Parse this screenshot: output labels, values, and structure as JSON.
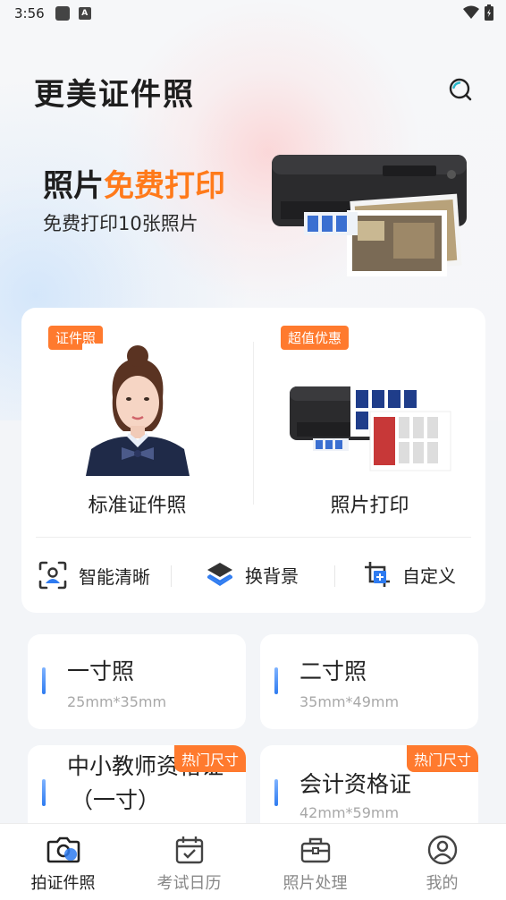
{
  "status_bar": {
    "time": "3:56"
  },
  "header": {
    "title": "更美证件照"
  },
  "promo": {
    "headline_plain": "照片",
    "headline_accent": "免费打印",
    "subtext": "免费打印10张照片"
  },
  "features": {
    "left": {
      "badge": "证件照",
      "label": "标准证件照"
    },
    "right": {
      "badge": "超值优惠",
      "label": "照片打印"
    }
  },
  "tools": [
    {
      "label": "智能清晰",
      "icon": "face-scan-icon"
    },
    {
      "label": "换背景",
      "icon": "layers-icon"
    },
    {
      "label": "自定义",
      "icon": "crop-add-icon"
    }
  ],
  "sizes": [
    {
      "name": "一寸照",
      "dim": "25mm*35mm"
    },
    {
      "name": "二寸照",
      "dim": "35mm*49mm"
    },
    {
      "name_line1": "中小教师资格证",
      "name_line2": "（一寸）",
      "badge": "热门尺寸"
    },
    {
      "name": "会计资格证",
      "dim": "42mm*59mm",
      "badge": "热门尺寸"
    }
  ],
  "tabs": [
    {
      "label": "拍证件照",
      "icon": "camera-icon",
      "active": true
    },
    {
      "label": "考试日历",
      "icon": "calendar-icon",
      "active": false
    },
    {
      "label": "照片处理",
      "icon": "toolbox-icon",
      "active": false
    },
    {
      "label": "我的",
      "icon": "user-icon",
      "active": false
    }
  ],
  "colors": {
    "accent": "#ff7a1a",
    "badge": "#ff7a2e",
    "blue": "#2e7bf0"
  }
}
